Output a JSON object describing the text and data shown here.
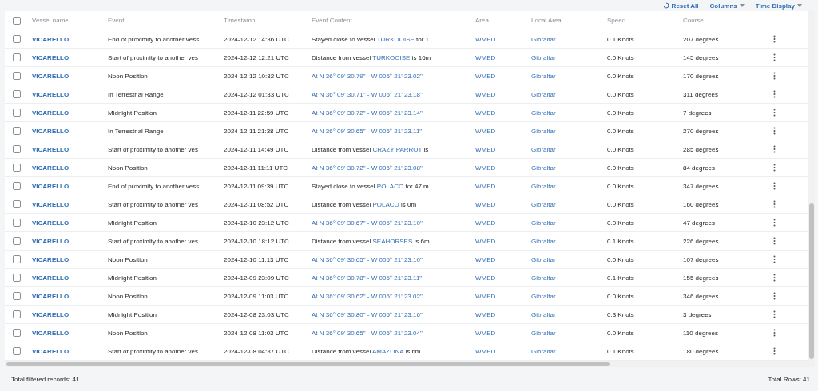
{
  "toolbar": {
    "buttons": [
      {
        "kind": "reset",
        "label": "Reset All"
      },
      {
        "kind": "dropdown",
        "label": "Columns"
      },
      {
        "kind": "dropdown",
        "label": "Time Display"
      }
    ]
  },
  "table": {
    "all_selected": false,
    "columns": [
      "Vessel name",
      "Event",
      "Timestamp",
      "Event Content",
      "Area",
      "Local Area",
      "Speed",
      "Course"
    ],
    "rows": [
      {
        "checked": false,
        "vessel": "VICARELLO",
        "event": "End of proximity to another vess",
        "timestamp": "2024-12-12 14:36 UTC",
        "content": {
          "kind": "vessel",
          "prefix": "Stayed close to vessel",
          "vessel": "TURKOOISE",
          "suffix": "for 1"
        },
        "area": "WMED",
        "local_area": "Gibraltar",
        "speed": "0.1 Knots",
        "course": "207 degrees"
      },
      {
        "checked": false,
        "vessel": "VICARELLO",
        "event": "Start of proximity to another ves",
        "timestamp": "2024-12-12 12:21 UTC",
        "content": {
          "kind": "vessel",
          "prefix": "Distance from vessel",
          "vessel": "TURKOOISE",
          "suffix": "is 16m"
        },
        "area": "WMED",
        "local_area": "Gibraltar",
        "speed": "0.0 Knots",
        "course": "145 degrees"
      },
      {
        "checked": false,
        "vessel": "VICARELLO",
        "event": "Noon Position",
        "timestamp": "2024-12-12 10:32 UTC",
        "content": {
          "kind": "position",
          "text": "At N 36° 09' 30.79\" - W 005° 21' 23.02\""
        },
        "area": "WMED",
        "local_area": "Gibraltar",
        "speed": "0.0 Knots",
        "course": "170 degrees"
      },
      {
        "checked": false,
        "vessel": "VICARELLO",
        "event": "In Terrestrial Range",
        "timestamp": "2024-12-12 01:33 UTC",
        "content": {
          "kind": "position",
          "text": "At N 36° 09' 30.71\" - W 005° 21' 23.18\""
        },
        "area": "WMED",
        "local_area": "Gibraltar",
        "speed": "0.0 Knots",
        "course": "311 degrees"
      },
      {
        "checked": false,
        "vessel": "VICARELLO",
        "event": "Midnight Position",
        "timestamp": "2024-12-11 22:59 UTC",
        "content": {
          "kind": "position",
          "text": "At N 36° 09' 30.72\" - W 005° 21' 23.14\""
        },
        "area": "WMED",
        "local_area": "Gibraltar",
        "speed": "0.0 Knots",
        "course": "7 degrees"
      },
      {
        "checked": false,
        "vessel": "VICARELLO",
        "event": "In Terrestrial Range",
        "timestamp": "2024-12-11 21:38 UTC",
        "content": {
          "kind": "position",
          "text": "At N 36° 09' 30.65\" - W 005° 21' 23.11\""
        },
        "area": "WMED",
        "local_area": "Gibraltar",
        "speed": "0.0 Knots",
        "course": "270 degrees"
      },
      {
        "checked": false,
        "vessel": "VICARELLO",
        "event": "Start of proximity to another ves",
        "timestamp": "2024-12-11 14:49 UTC",
        "content": {
          "kind": "vessel",
          "prefix": "Distance from vessel",
          "vessel": "CRAZY PARROT",
          "suffix": "is"
        },
        "area": "WMED",
        "local_area": "Gibraltar",
        "speed": "0.0 Knots",
        "course": "285 degrees"
      },
      {
        "checked": false,
        "vessel": "VICARELLO",
        "event": "Noon Position",
        "timestamp": "2024-12-11 11:11 UTC",
        "content": {
          "kind": "position",
          "text": "At N 36° 09' 30.72\" - W 005° 21' 23.08\""
        },
        "area": "WMED",
        "local_area": "Gibraltar",
        "speed": "0.0 Knots",
        "course": "84 degrees"
      },
      {
        "checked": false,
        "vessel": "VICARELLO",
        "event": "End of proximity to another vess",
        "timestamp": "2024-12-11 09:39 UTC",
        "content": {
          "kind": "vessel",
          "prefix": "Stayed close to vessel",
          "vessel": "POLACO",
          "suffix": "for 47 m"
        },
        "area": "WMED",
        "local_area": "Gibraltar",
        "speed": "0.0 Knots",
        "course": "347 degrees"
      },
      {
        "checked": false,
        "vessel": "VICARELLO",
        "event": "Start of proximity to another ves",
        "timestamp": "2024-12-11 08:52 UTC",
        "content": {
          "kind": "vessel",
          "prefix": "Distance from vessel",
          "vessel": "POLACO",
          "suffix": "is 0m"
        },
        "area": "WMED",
        "local_area": "Gibraltar",
        "speed": "0.0 Knots",
        "course": "160 degrees"
      },
      {
        "checked": false,
        "vessel": "VICARELLO",
        "event": "Midnight Position",
        "timestamp": "2024-12-10 23:12 UTC",
        "content": {
          "kind": "position",
          "text": "At N 36° 09' 30.67\" - W 005° 21' 23.10\""
        },
        "area": "WMED",
        "local_area": "Gibraltar",
        "speed": "0.0 Knots",
        "course": "47 degrees"
      },
      {
        "checked": false,
        "vessel": "VICARELLO",
        "event": "Start of proximity to another ves",
        "timestamp": "2024-12-10 18:12 UTC",
        "content": {
          "kind": "vessel",
          "prefix": "Distance from vessel",
          "vessel": "SEAHORSES",
          "suffix": "is 6m"
        },
        "area": "WMED",
        "local_area": "Gibraltar",
        "speed": "0.1 Knots",
        "course": "226 degrees"
      },
      {
        "checked": false,
        "vessel": "VICARELLO",
        "event": "Noon Position",
        "timestamp": "2024-12-10 11:13 UTC",
        "content": {
          "kind": "position",
          "text": "At N 36° 09' 30.65\" - W 005° 21' 23.10\""
        },
        "area": "WMED",
        "local_area": "Gibraltar",
        "speed": "0.0 Knots",
        "course": "107 degrees"
      },
      {
        "checked": false,
        "vessel": "VICARELLO",
        "event": "Midnight Position",
        "timestamp": "2024-12-09 23:09 UTC",
        "content": {
          "kind": "position",
          "text": "At N 36° 09' 30.78\" - W 005° 21' 23.11\""
        },
        "area": "WMED",
        "local_area": "Gibraltar",
        "speed": "0.1 Knots",
        "course": "155 degrees"
      },
      {
        "checked": false,
        "vessel": "VICARELLO",
        "event": "Noon Position",
        "timestamp": "2024-12-09 11:03 UTC",
        "content": {
          "kind": "position",
          "text": "At N 36° 09' 30.62\" - W 005° 21' 23.02\""
        },
        "area": "WMED",
        "local_area": "Gibraltar",
        "speed": "0.0 Knots",
        "course": "346 degrees"
      },
      {
        "checked": false,
        "vessel": "VICARELLO",
        "event": "Midnight Position",
        "timestamp": "2024-12-08 23:03 UTC",
        "content": {
          "kind": "position",
          "text": "At N 36° 09' 30.80\" - W 005° 21' 23.16\""
        },
        "area": "WMED",
        "local_area": "Gibraltar",
        "speed": "0.3 Knots",
        "course": "3 degrees"
      },
      {
        "checked": false,
        "vessel": "VICARELLO",
        "event": "Noon Position",
        "timestamp": "2024-12-08 11:03 UTC",
        "content": {
          "kind": "position",
          "text": "At N 36° 09' 30.65\" - W 005° 21' 23.04\""
        },
        "area": "WMED",
        "local_area": "Gibraltar",
        "speed": "0.0 Knots",
        "course": "110 degrees"
      },
      {
        "checked": false,
        "vessel": "VICARELLO",
        "event": "Start of proximity to another ves",
        "timestamp": "2024-12-08 04:37 UTC",
        "content": {
          "kind": "vessel",
          "prefix": "Distance from vessel",
          "vessel": "AMAZONA",
          "suffix": "is 6m"
        },
        "area": "WMED",
        "local_area": "Gibraltar",
        "speed": "0.1 Knots",
        "course": "180 degrees"
      }
    ]
  },
  "footer": {
    "filtered": "Total filtered records: 41",
    "total": "Total Rows: 41"
  }
}
